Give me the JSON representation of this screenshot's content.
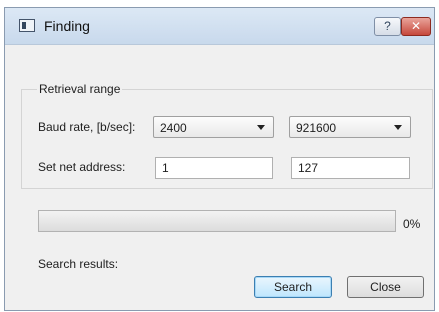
{
  "window": {
    "title": "Finding",
    "help_label": "?",
    "close_label": "✕"
  },
  "retrieval_range": {
    "title": "Retrieval range",
    "baud_label": "Baud rate, [b/sec]:",
    "baud_from": "2400",
    "baud_to": "921600",
    "net_label": "Set net address:",
    "net_from": "1",
    "net_to": "127"
  },
  "progress": {
    "percent_text": "0%",
    "value": 0
  },
  "results": {
    "label": "Search results:"
  },
  "buttons": {
    "search": "Search",
    "close": "Close"
  },
  "colors": {
    "title_bar": "#c8d9ec",
    "close_button": "#c6483c",
    "default_button": "#bee6fd",
    "progress_fill": "#06b025"
  }
}
